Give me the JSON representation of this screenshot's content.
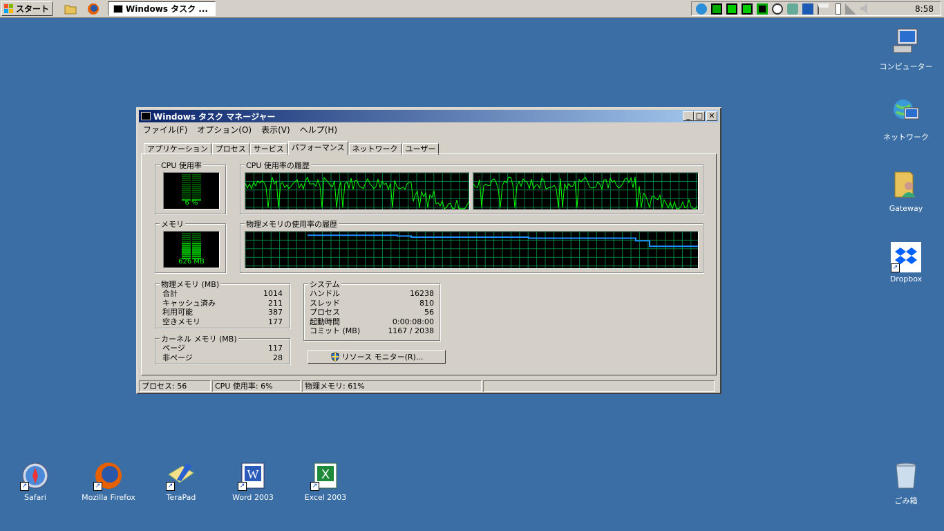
{
  "taskbar": {
    "start_label": "スタート",
    "task_button_label": "Windows タスク ...",
    "clock": "8:58"
  },
  "desktop_icons_right": [
    {
      "label": "コンピューター"
    },
    {
      "label": "ネットワーク"
    },
    {
      "label": "Gateway"
    },
    {
      "label": "Dropbox"
    },
    {
      "label": "ごみ箱"
    }
  ],
  "desktop_icons_bottom": [
    {
      "label": "Safari"
    },
    {
      "label": "Mozilla Firefox"
    },
    {
      "label": "TeraPad"
    },
    {
      "label": "Word 2003"
    },
    {
      "label": "Excel 2003"
    }
  ],
  "window": {
    "title": "Windows タスク マネージャー",
    "menu": [
      "ファイル(F)",
      "オプション(O)",
      "表示(V)",
      "ヘルプ(H)"
    ],
    "tabs": [
      "アプリケーション",
      "プロセス",
      "サービス",
      "パフォーマンス",
      "ネットワーク",
      "ユーザー"
    ],
    "active_tab": "パフォーマンス"
  },
  "performance": {
    "cpu_usage": {
      "title": "CPU 使用率",
      "value": "6 %",
      "percent": 6
    },
    "cpu_history": {
      "title": "CPU 使用率の履歴"
    },
    "memory": {
      "title": "メモリ",
      "value": "626 MB",
      "percent": 61
    },
    "memory_history": {
      "title": "物理メモリの使用率の履歴"
    },
    "physical_memory": {
      "title": "物理メモリ (MB)",
      "rows": [
        {
          "label": "合計",
          "value": "1014"
        },
        {
          "label": "キャッシュ済み",
          "value": "211"
        },
        {
          "label": "利用可能",
          "value": "387"
        },
        {
          "label": "空きメモリ",
          "value": "177"
        }
      ]
    },
    "kernel_memory": {
      "title": "カーネル メモリ (MB)",
      "rows": [
        {
          "label": "ページ",
          "value": "117"
        },
        {
          "label": "非ページ",
          "value": "28"
        }
      ]
    },
    "system": {
      "title": "システム",
      "rows": [
        {
          "label": "ハンドル",
          "value": "16238"
        },
        {
          "label": "スレッド",
          "value": "810"
        },
        {
          "label": "プロセス",
          "value": "56"
        },
        {
          "label": "起動時間",
          "value": "0:00:08:00"
        },
        {
          "label": "コミット (MB)",
          "value": "1167 / 2038"
        }
      ]
    },
    "resource_monitor_button": "リソース モニター(R)..."
  },
  "status_bar": {
    "processes": "プロセス: 56",
    "cpu": "CPU 使用率: 6%",
    "memory": "物理メモリ: 61%"
  },
  "colors": {
    "desktop": "#3a6ea5",
    "graph_grid": "#008040",
    "cpu_line": "#00ff00",
    "mem_line": "#1e90ff"
  }
}
